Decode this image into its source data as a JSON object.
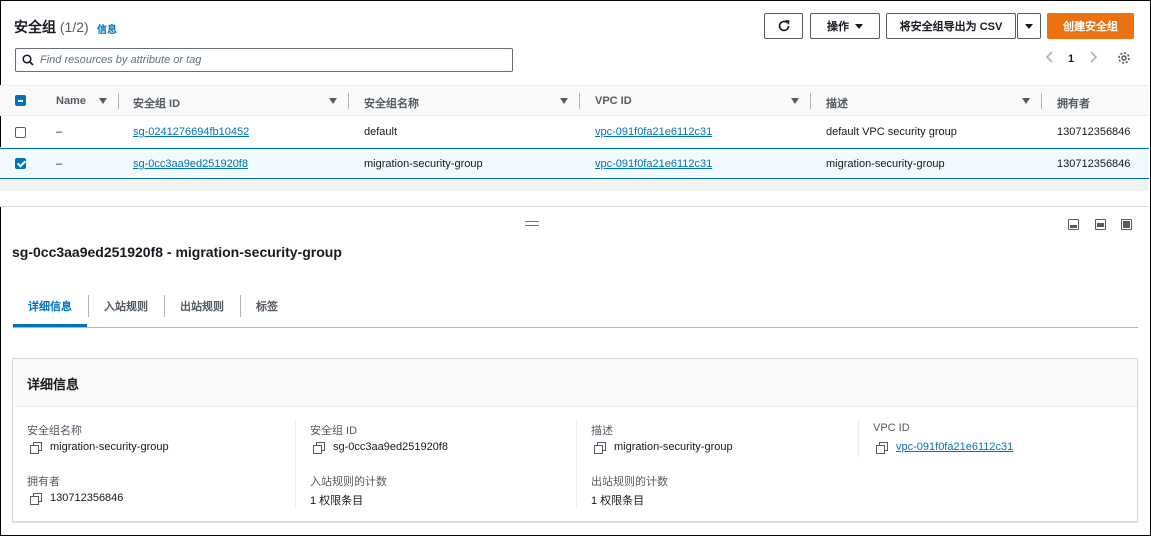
{
  "header": {
    "title": "安全组",
    "count": "(1/2)",
    "info_link": "信息",
    "actions_label": "操作",
    "export_label": "将安全组导出为 CSV",
    "create_label": "创建安全组"
  },
  "search": {
    "placeholder": "Find resources by attribute or tag"
  },
  "pagination": {
    "current_page": "1"
  },
  "table": {
    "columns": [
      "Name",
      "安全组 ID",
      "安全组名称",
      "VPC ID",
      "描述",
      "拥有者"
    ],
    "rows": [
      {
        "selected": false,
        "name": "–",
        "sg_id": "sg-0241276694fb10452",
        "sg_name": "default",
        "vpc_id": "vpc-091f0fa21e6112c31",
        "description": "default VPC security group",
        "owner": "130712356846"
      },
      {
        "selected": true,
        "name": "–",
        "sg_id": "sg-0cc3aa9ed251920f8",
        "sg_name": "migration-security-group",
        "vpc_id": "vpc-091f0fa21e6112c31",
        "description": "migration-security-group",
        "owner": "130712356846"
      }
    ]
  },
  "detail": {
    "title": "sg-0cc3aa9ed251920f8 - migration-security-group",
    "tabs": [
      "详细信息",
      "入站规则",
      "出站规则",
      "标签"
    ],
    "active_tab": "详细信息",
    "card_title": "详细信息",
    "fields": {
      "sg_name_label": "安全组名称",
      "sg_name_value": "migration-security-group",
      "sg_id_label": "安全组 ID",
      "sg_id_value": "sg-0cc3aa9ed251920f8",
      "desc_label": "描述",
      "desc_value": "migration-security-group",
      "vpc_label": "VPC ID",
      "vpc_value": "vpc-091f0fa21e6112c31",
      "owner_label": "拥有者",
      "owner_value": "130712356846",
      "inbound_label": "入站规则的计数",
      "inbound_value": "1 权限条目",
      "outbound_label": "出站规则的计数",
      "outbound_value": "1 权限条目"
    }
  },
  "icons": {
    "refresh": "refresh-icon",
    "caret": "caret-down-icon",
    "search": "search-icon",
    "prev": "chevron-left-icon",
    "next": "chevron-right-icon",
    "settings": "gear-icon",
    "copy": "copy-icon"
  },
  "colors": {
    "primary_button": "#ec7211",
    "link": "#0073bb",
    "selected_row": "#f1faff"
  }
}
